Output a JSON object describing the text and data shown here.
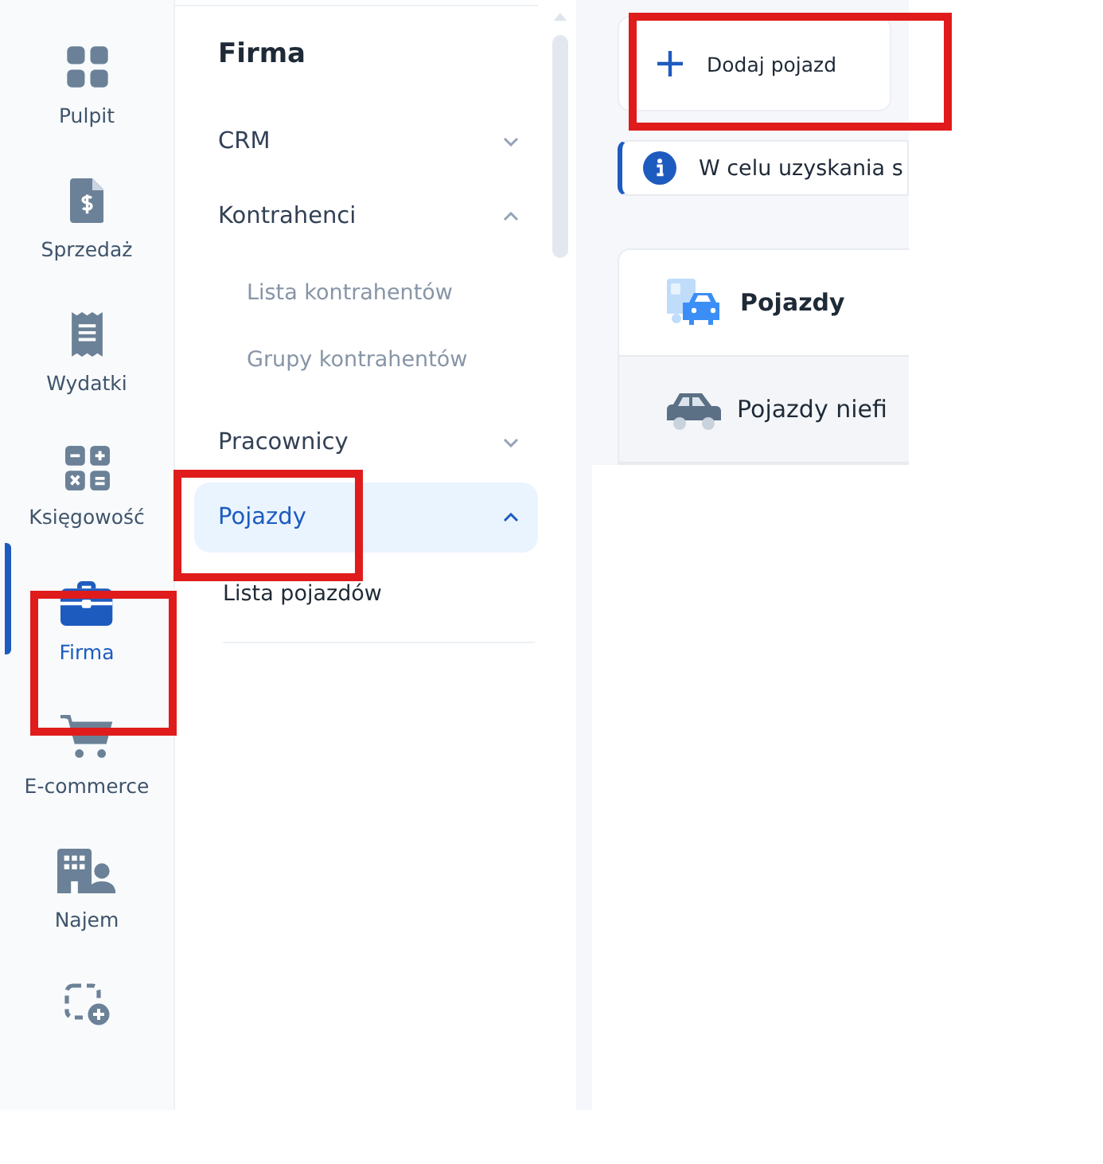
{
  "rail": [
    {
      "label": "Pulpit",
      "selected": false
    },
    {
      "label": "Sprzedaż",
      "selected": false
    },
    {
      "label": "Wydatki",
      "selected": false
    },
    {
      "label": "Księgowość",
      "selected": false
    },
    {
      "label": "Firma",
      "selected": true
    },
    {
      "label": "E-commerce",
      "selected": false
    },
    {
      "label": "Najem",
      "selected": false
    },
    {
      "selected": false
    }
  ],
  "submenu": {
    "title": "Firma",
    "groups": [
      {
        "label": "CRM",
        "expanded": false,
        "selected": false
      },
      {
        "label": "Kontrahenci",
        "expanded": true,
        "selected": false,
        "children": [
          {
            "label": "Lista kontrahentów",
            "selected": false
          },
          {
            "label": "Grupy kontrahentów",
            "selected": false
          }
        ]
      },
      {
        "label": "Pracownicy",
        "expanded": false,
        "selected": false
      },
      {
        "label": "Pojazdy",
        "expanded": true,
        "selected": true,
        "children": [
          {
            "label": "Lista pojazdów",
            "selected": true
          }
        ]
      }
    ]
  },
  "add_button": {
    "label": "Dodaj pojazd"
  },
  "info": {
    "text": "W celu uzyskania s"
  },
  "tabs": [
    {
      "label": "Pojazdy",
      "selected": true
    },
    {
      "label": "Pojazdy niefi",
      "selected": false
    }
  ]
}
